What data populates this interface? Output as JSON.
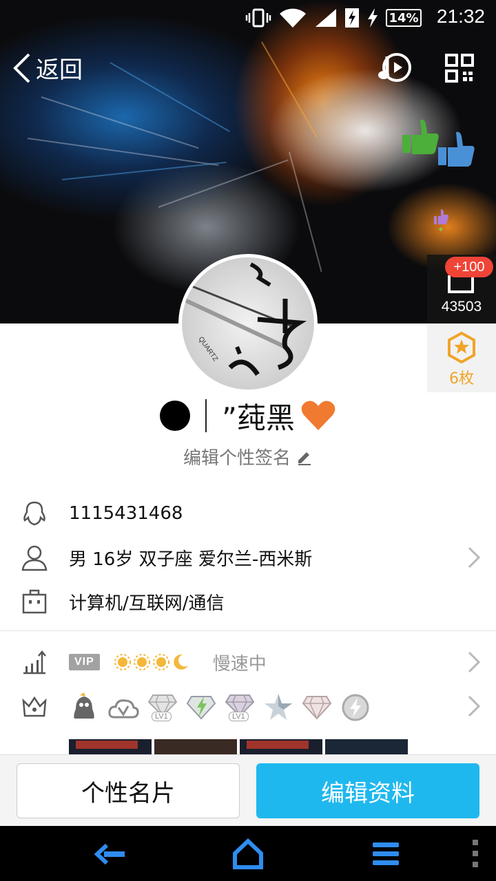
{
  "status_bar": {
    "battery": "14%",
    "time": "21:32"
  },
  "header": {
    "back_label": "返回"
  },
  "like_panel": {
    "badge": "+100",
    "count": "43503"
  },
  "medal_panel": {
    "count": "6枚"
  },
  "profile": {
    "name_prefix_symbol": "●",
    "name": "”莼黑",
    "name_suffix_symbol": "♥",
    "signature": "编辑个性签名"
  },
  "info": {
    "qq_number": "1115431468",
    "personal": "男  16岁  双子座  爱尔兰-西米斯",
    "occupation": "计算机/互联网/通信"
  },
  "vip_row": {
    "vip_tag": "VIP",
    "speed_status": "慢速中"
  },
  "badges": {
    "lv1_a": "LV1",
    "lv1_b": "LV1"
  },
  "actions": {
    "card_button": "个性名片",
    "edit_button": "编辑资料"
  },
  "colors": {
    "accent_blue": "#1fb8ee",
    "badge_red": "#f04437",
    "medal_orange": "#f0a428",
    "heart_orange": "#f07a30"
  }
}
